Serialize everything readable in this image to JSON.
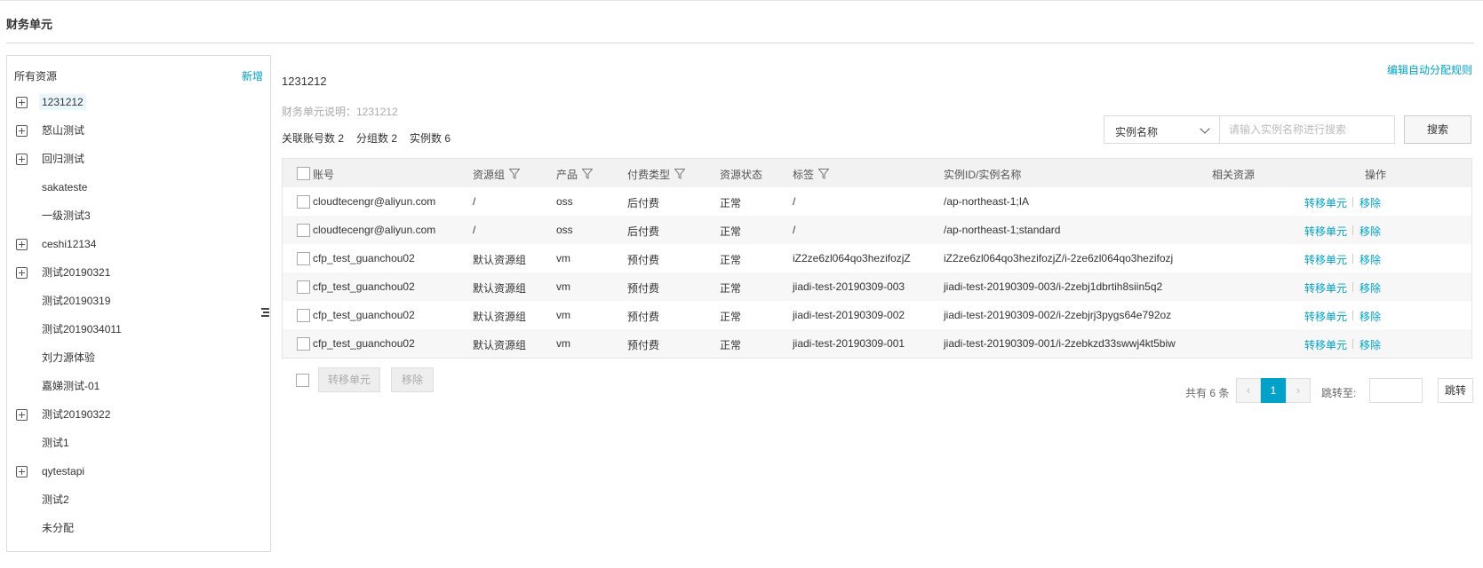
{
  "page": {
    "title": "财务单元"
  },
  "sidebar": {
    "title": "所有资源",
    "add_label": "新增",
    "items": [
      {
        "label": "1231212",
        "expandable": true,
        "selected": true
      },
      {
        "label": "怒山测试",
        "expandable": true
      },
      {
        "label": "回归测试",
        "expandable": true
      },
      {
        "label": "sakateste",
        "expandable": false
      },
      {
        "label": "一级测试3",
        "expandable": false
      },
      {
        "label": "ceshi12134",
        "expandable": true
      },
      {
        "label": "测试20190321",
        "expandable": true
      },
      {
        "label": "测试20190319",
        "expandable": false
      },
      {
        "label": "测试2019034011",
        "expandable": false
      },
      {
        "label": "刘力源体验",
        "expandable": false
      },
      {
        "label": "嘉娣测试-01",
        "expandable": false
      },
      {
        "label": "测试20190322",
        "expandable": true
      },
      {
        "label": "测试1",
        "expandable": false
      },
      {
        "label": "qytestapi",
        "expandable": true
      },
      {
        "label": "测试2",
        "expandable": false
      },
      {
        "label": "未分配",
        "expandable": false
      }
    ]
  },
  "main": {
    "unit_name": "1231212",
    "unit_desc": "财务单元说明：1231212",
    "edit_rule_label": "编辑自动分配规则",
    "stats": {
      "accounts": "关联账号数 2",
      "groups": "分组数 2",
      "instances": "实例数 6"
    },
    "search": {
      "select_value": "实例名称",
      "placeholder": "请输入实例名称进行搜索",
      "button_label": "搜索"
    },
    "table": {
      "headers": {
        "account": "账号",
        "resource_group": "资源组",
        "product": "产品",
        "billing_type": "付费类型",
        "status": "资源状态",
        "tag": "标签",
        "instance": "实例ID/实例名称",
        "related": "相关资源",
        "actions": "操作"
      },
      "rows": [
        {
          "account": "cloudtecengr@aliyun.com",
          "group": "/",
          "product": "oss",
          "billing": "后付费",
          "status": "正常",
          "tag": "/",
          "instance": "/ap-northeast-1;IA"
        },
        {
          "account": "cloudtecengr@aliyun.com",
          "group": "/",
          "product": "oss",
          "billing": "后付费",
          "status": "正常",
          "tag": "/",
          "instance": "/ap-northeast-1;standard"
        },
        {
          "account": "cfp_test_guanchou02",
          "group": "默认资源组",
          "product": "vm",
          "billing": "预付费",
          "status": "正常",
          "tag": "iZ2ze6zl064qo3hezifozjZ",
          "instance": "iZ2ze6zl064qo3hezifozjZ/i-2ze6zl064qo3hezifozj"
        },
        {
          "account": "cfp_test_guanchou02",
          "group": "默认资源组",
          "product": "vm",
          "billing": "预付费",
          "status": "正常",
          "tag": "jiadi-test-20190309-003",
          "instance": "jiadi-test-20190309-003/i-2zebj1dbrtih8siin5q2"
        },
        {
          "account": "cfp_test_guanchou02",
          "group": "默认资源组",
          "product": "vm",
          "billing": "预付费",
          "status": "正常",
          "tag": "jiadi-test-20190309-002",
          "instance": "jiadi-test-20190309-002/i-2zebjrj3pygs64e792oz"
        },
        {
          "account": "cfp_test_guanchou02",
          "group": "默认资源组",
          "product": "vm",
          "billing": "预付费",
          "status": "正常",
          "tag": "jiadi-test-20190309-001",
          "instance": "jiadi-test-20190309-001/i-2zebkzd33swwj4kt5biw"
        }
      ],
      "row_action_transfer": "转移单元",
      "row_action_remove": "移除"
    },
    "footer": {
      "transfer_label": "转移单元",
      "remove_label": "移除"
    },
    "pager": {
      "total": "共有 6 条",
      "prev": "‹",
      "current": "1",
      "next": "›",
      "jump_label": "跳转至:",
      "jump_button": "跳转"
    }
  },
  "colors": {
    "accent": "#00a2ca",
    "selected_bg": "#e9f6fb"
  }
}
